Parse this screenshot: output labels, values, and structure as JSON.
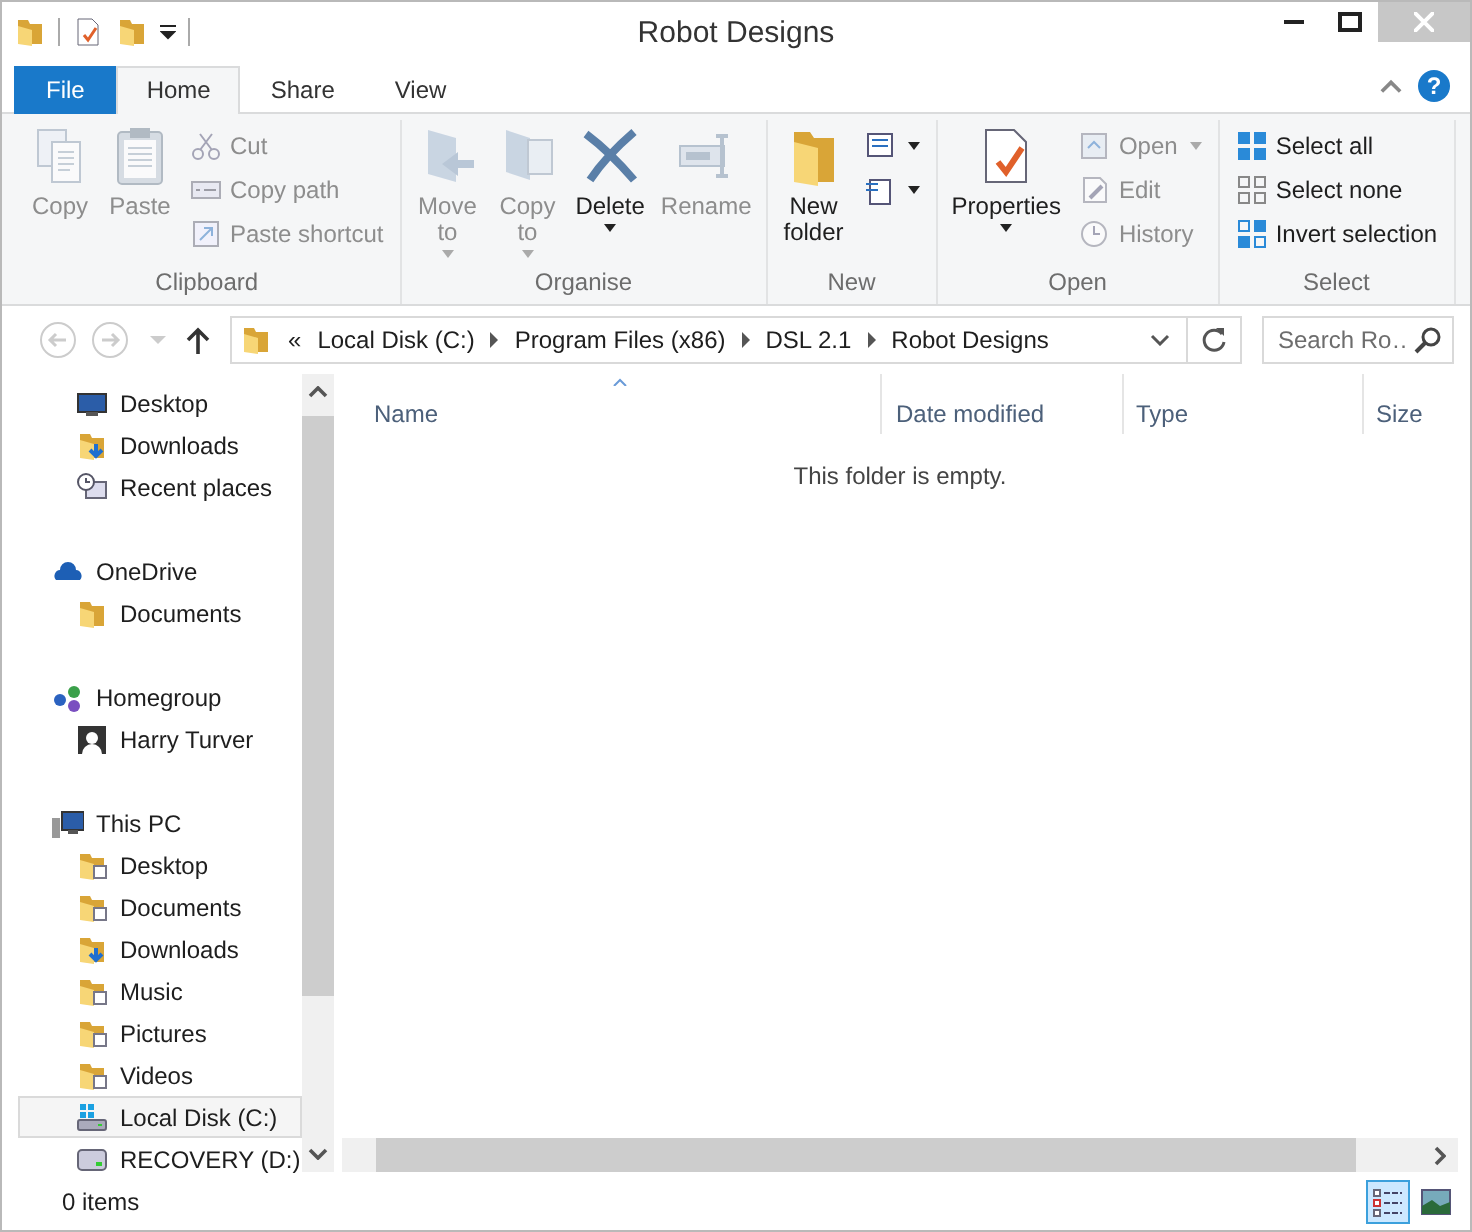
{
  "window": {
    "title": "Robot Designs"
  },
  "tabs": [
    {
      "label": "File",
      "kind": "file",
      "selected": false
    },
    {
      "label": "Home",
      "kind": "tab",
      "selected": true
    },
    {
      "label": "Share",
      "kind": "tab",
      "selected": false
    },
    {
      "label": "View",
      "kind": "tab",
      "selected": false
    }
  ],
  "help": "?",
  "ribbon": {
    "groups": [
      {
        "label": "Clipboard",
        "items": [
          {
            "kind": "large",
            "label": "Copy",
            "disabled": true,
            "dropdown": false
          },
          {
            "kind": "large",
            "label": "Paste",
            "disabled": true,
            "dropdown": false
          },
          {
            "kind": "small",
            "label": "Cut",
            "disabled": true,
            "dropdown": false
          },
          {
            "kind": "small",
            "label": "Copy path",
            "disabled": true,
            "dropdown": false
          },
          {
            "kind": "small",
            "label": "Paste shortcut",
            "disabled": true,
            "dropdown": false
          }
        ]
      },
      {
        "label": "Organise",
        "items": [
          {
            "kind": "large",
            "label": "Move to",
            "disabled": true,
            "dropdown": true
          },
          {
            "kind": "large",
            "label": "Copy to",
            "disabled": true,
            "dropdown": true
          },
          {
            "kind": "large",
            "label": "Delete",
            "disabled": false,
            "dropdown": true
          },
          {
            "kind": "large",
            "label": "Rename",
            "disabled": true,
            "dropdown": false
          }
        ]
      },
      {
        "label": "New",
        "items": [
          {
            "kind": "large",
            "label": "New folder",
            "disabled": false,
            "dropdown": false
          },
          {
            "kind": "small",
            "disabled": false,
            "dropdown": true
          },
          {
            "kind": "small",
            "disabled": false,
            "dropdown": true
          }
        ]
      },
      {
        "label": "Open",
        "items": [
          {
            "kind": "large",
            "label": "Properties",
            "disabled": false,
            "dropdown": true
          },
          {
            "kind": "small",
            "label": "Open",
            "disabled": true,
            "dropdown": true
          },
          {
            "kind": "small",
            "label": "Edit",
            "disabled": true,
            "dropdown": false
          },
          {
            "kind": "small",
            "label": "History",
            "disabled": true,
            "dropdown": false
          }
        ]
      },
      {
        "label": "Select",
        "items": [
          {
            "kind": "small",
            "label": "Select all",
            "disabled": false,
            "dropdown": false
          },
          {
            "kind": "small",
            "label": "Select none",
            "disabled": false,
            "dropdown": false
          },
          {
            "kind": "small",
            "label": "Invert selection",
            "disabled": false,
            "dropdown": false
          }
        ]
      }
    ]
  },
  "address": {
    "overflow": "«",
    "crumbs": [
      "Local Disk (C:)",
      "Program Files (x86)",
      "DSL 2.1",
      "Robot Designs"
    ]
  },
  "search": {
    "placeholder": "Search Ro…"
  },
  "sidebar": {
    "sections": [
      {
        "children": [
          {
            "label": "Desktop",
            "selected": false
          },
          {
            "label": "Downloads",
            "selected": false
          },
          {
            "label": "Recent places",
            "selected": false
          }
        ]
      },
      {
        "label": "OneDrive",
        "children": [
          {
            "label": "Documents",
            "selected": false
          }
        ]
      },
      {
        "label": "Homegroup",
        "children": [
          {
            "label": "Harry Turver",
            "selected": false
          }
        ]
      },
      {
        "label": "This PC",
        "children": [
          {
            "label": "Desktop",
            "selected": false
          },
          {
            "label": "Documents",
            "selected": false
          },
          {
            "label": "Downloads",
            "selected": false
          },
          {
            "label": "Music",
            "selected": false
          },
          {
            "label": "Pictures",
            "selected": false
          },
          {
            "label": "Videos",
            "selected": false
          },
          {
            "label": "Local Disk (C:)",
            "selected": true
          },
          {
            "label": "RECOVERY (D:)",
            "selected": false
          }
        ]
      }
    ]
  },
  "table": {
    "columns": [
      {
        "label": "Name",
        "sorted": true
      },
      {
        "label": "Date modified",
        "sorted": false
      },
      {
        "label": "Type",
        "sorted": false
      },
      {
        "label": "Size",
        "sorted": false
      }
    ],
    "empty_message": "This folder is empty."
  },
  "status_bar": {
    "text": "0 items",
    "views": [
      {
        "kind": "details",
        "selected": true
      },
      {
        "kind": "large_icons",
        "selected": false
      }
    ]
  }
}
